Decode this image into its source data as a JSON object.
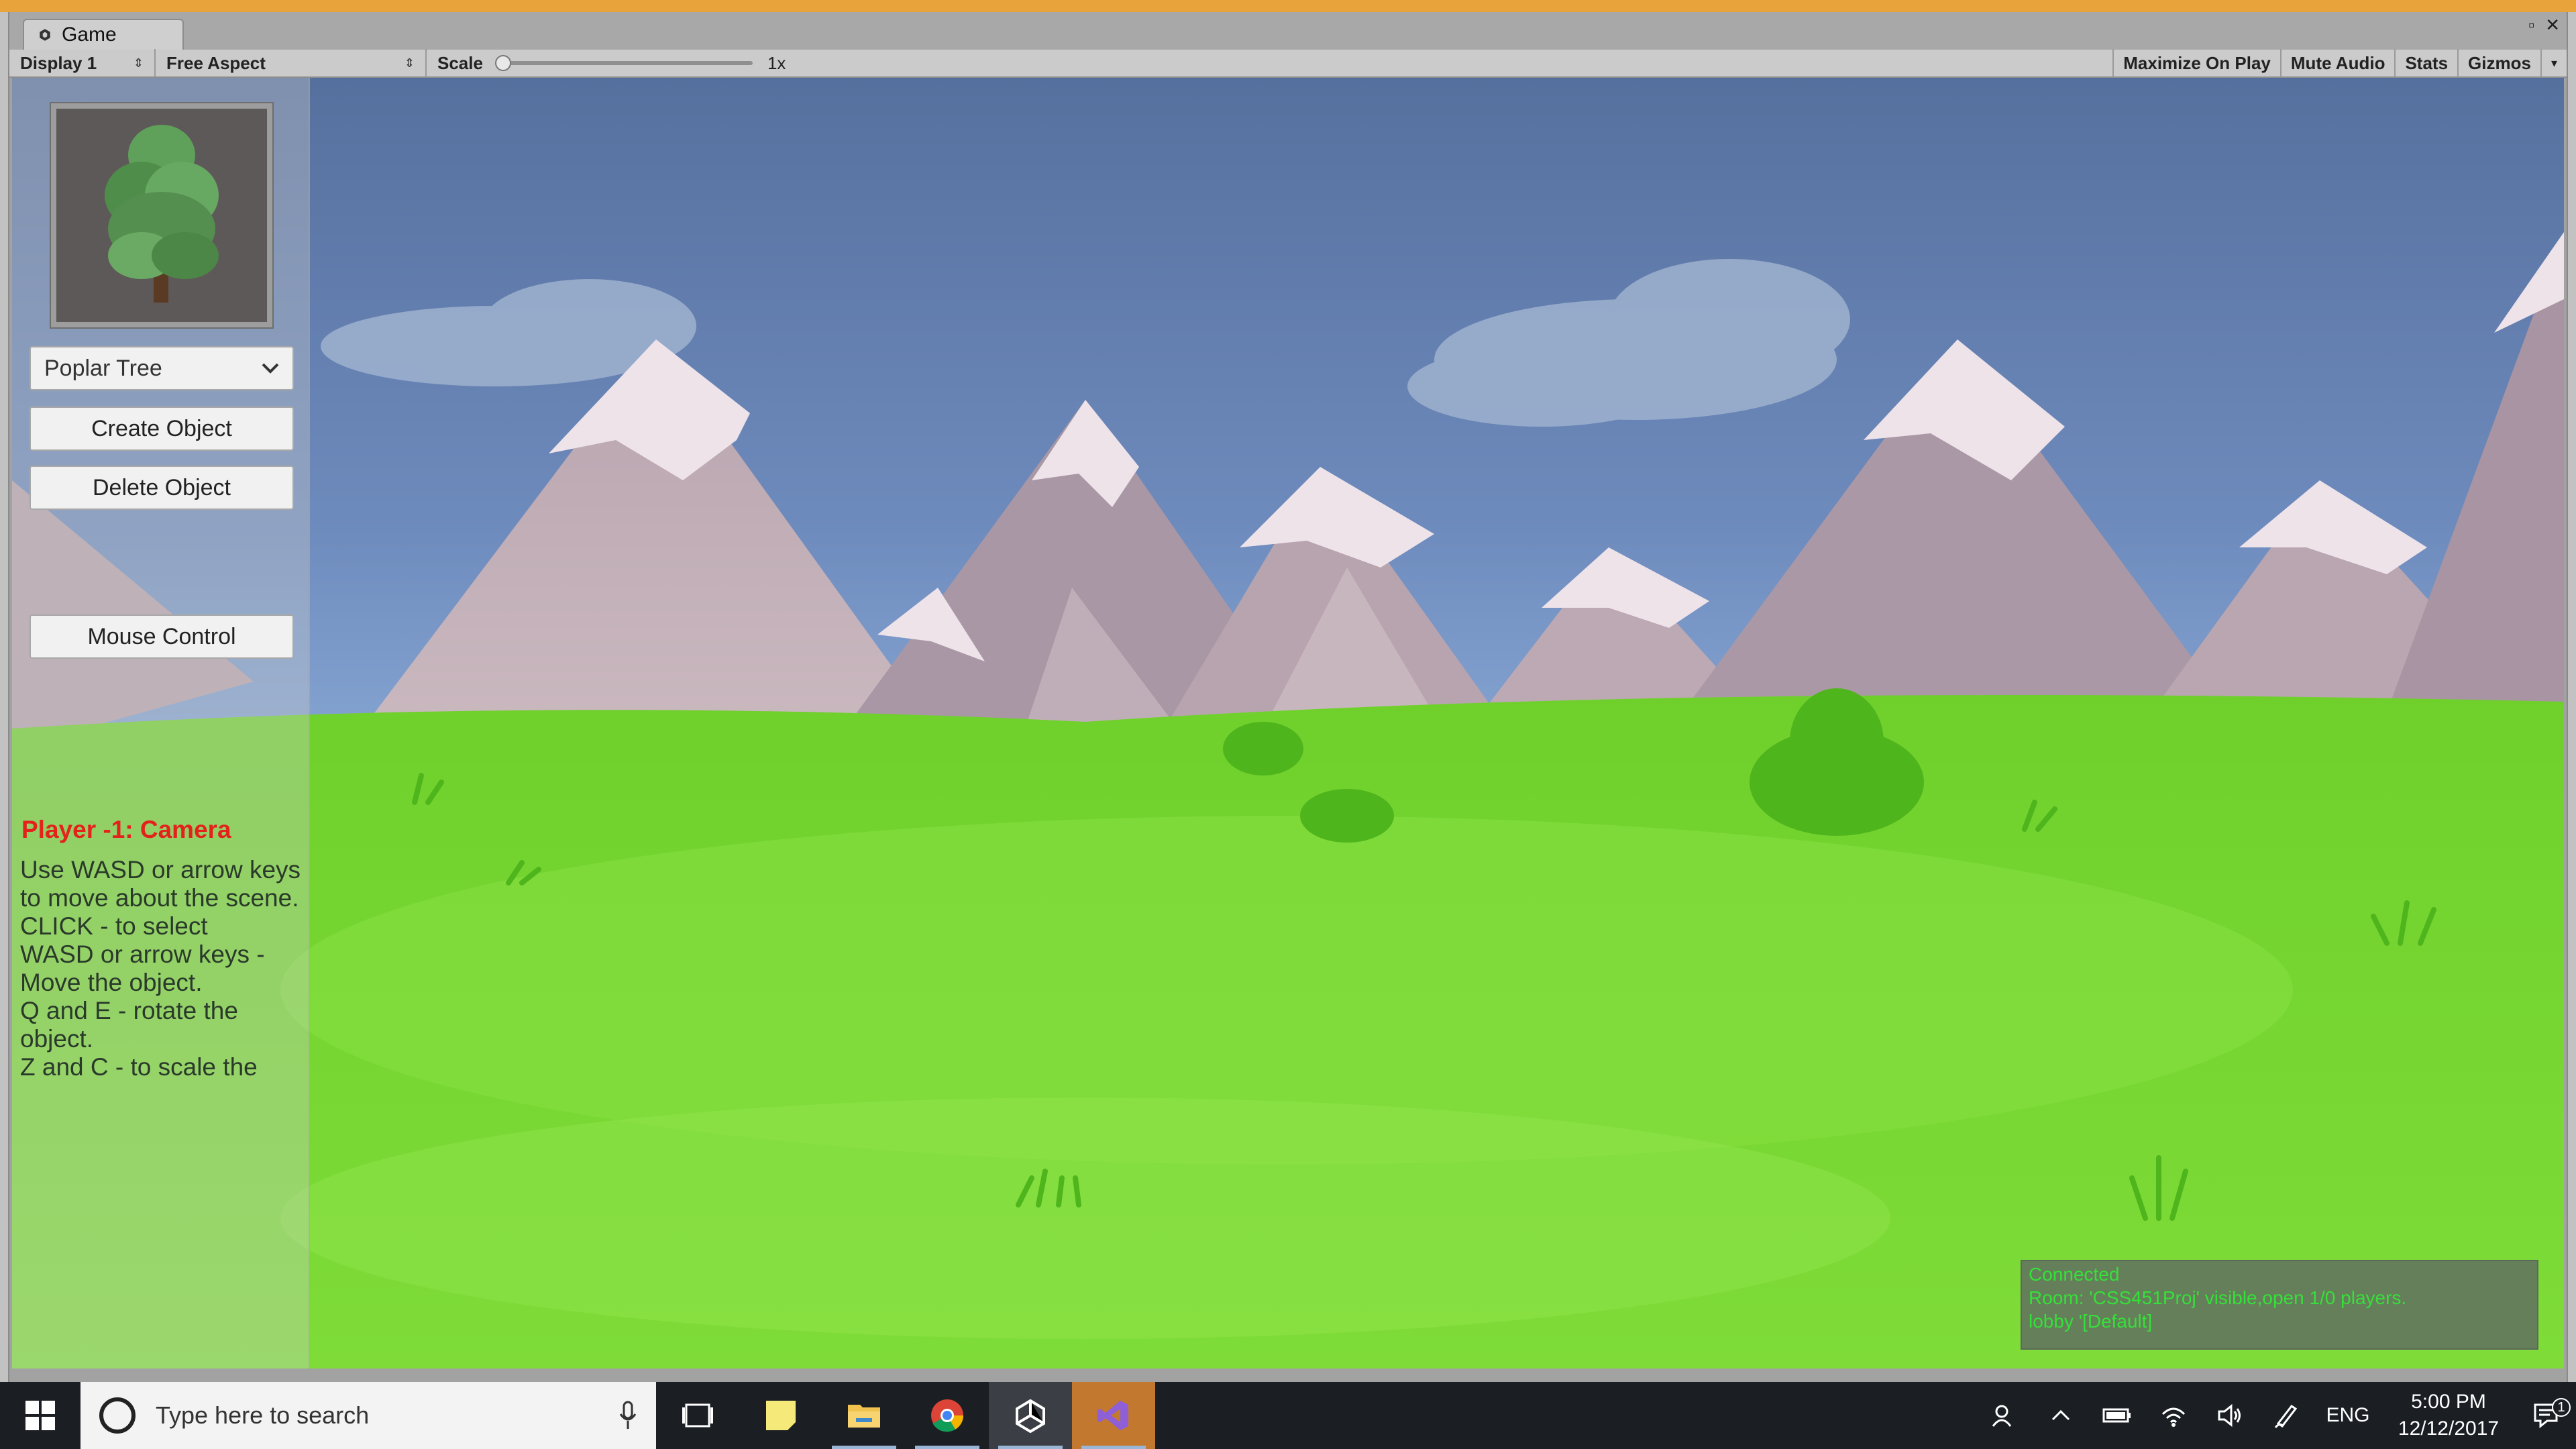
{
  "editor": {
    "tab_title": "Game",
    "toolbar": {
      "display": "Display 1",
      "aspect": "Free Aspect",
      "scale_label": "Scale",
      "scale_value": "1x",
      "maximize": "Maximize On Play",
      "mute": "Mute Audio",
      "stats": "Stats",
      "gizmos": "Gizmos"
    }
  },
  "game_ui": {
    "object_select": "Poplar Tree",
    "create_button": "Create Object",
    "delete_button": "Delete Object",
    "mouse_button": "Mouse Control",
    "player_title": "Player -1: Camera",
    "instructions_1": "Use WASD or arrow keys to move about the scene.",
    "instructions_2": "CLICK - to select\nWASD or arrow keys - Move the object.\nQ and E - rotate the object.\nZ and C - to scale the"
  },
  "network": {
    "status": "Connected",
    "room": "Room: 'CSS451Proj' visible,open 1/0 players.",
    "lobby": "lobby '[Default]"
  },
  "taskbar": {
    "search_placeholder": "Type here to search",
    "language": "ENG",
    "time": "5:00 PM",
    "date": "12/12/2017",
    "notification_count": "1"
  },
  "colors": {
    "title_red": "#e4221b",
    "net_text_green": "#36e03a",
    "editor_orange": "#e8a33a"
  },
  "icons": [
    "unity-icon",
    "poplar-tree-preview",
    "chevron-down-icon",
    "windows-start-icon",
    "cortana-icon",
    "microphone-icon",
    "task-view-icon",
    "sticky-notes-icon",
    "file-explorer-icon",
    "chrome-icon",
    "unity-taskbar-icon",
    "visual-studio-icon",
    "people-icon",
    "chevron-up-icon",
    "battery-icon",
    "wifi-icon",
    "volume-icon",
    "pen-icon",
    "notification-icon"
  ]
}
